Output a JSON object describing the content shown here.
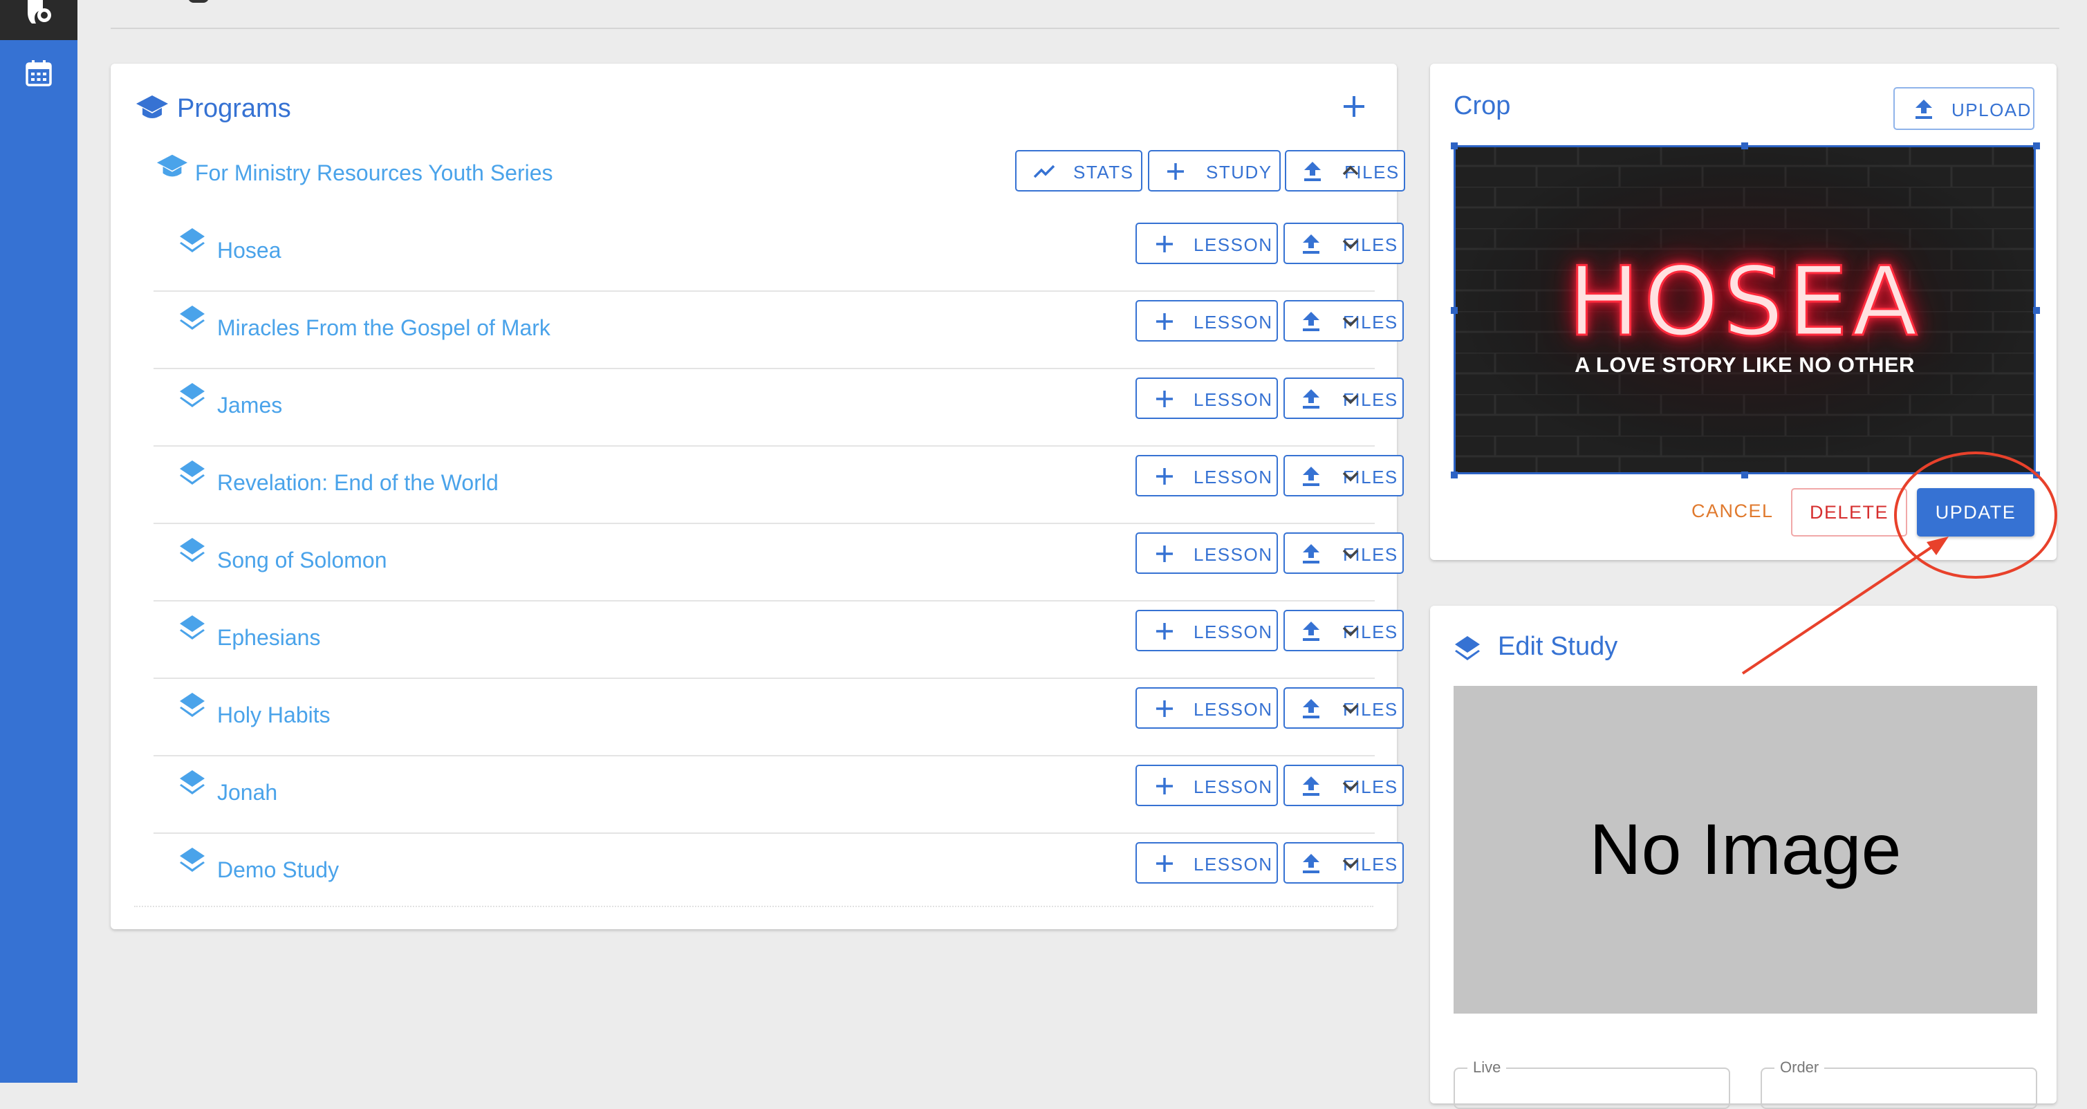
{
  "colors": {
    "accent": "#3672d3",
    "link": "#4aa3ea",
    "annotation": "#e8412b",
    "danger": "#d62f2f",
    "warning": "#e07a2e"
  },
  "nav": {
    "icons": [
      "logo-icon",
      "calendar-icon"
    ]
  },
  "programs": {
    "title": "Programs",
    "add_icon": "plus-icon",
    "series": {
      "name": "For Ministry Resources Youth Series",
      "buttons": {
        "stats": "STATS",
        "study": "STUDY",
        "files": "FILES"
      }
    },
    "studies": [
      {
        "name": "Hosea",
        "lesson": "LESSON",
        "files": "FILES"
      },
      {
        "name": "Miracles From the Gospel of Mark",
        "lesson": "LESSON",
        "files": "FILES"
      },
      {
        "name": "James",
        "lesson": "LESSON",
        "files": "FILES"
      },
      {
        "name": "Revelation: End of the World",
        "lesson": "LESSON",
        "files": "FILES"
      },
      {
        "name": "Song of Solomon",
        "lesson": "LESSON",
        "files": "FILES"
      },
      {
        "name": "Ephesians",
        "lesson": "LESSON",
        "files": "FILES"
      },
      {
        "name": "Holy Habits",
        "lesson": "LESSON",
        "files": "FILES"
      },
      {
        "name": "Jonah",
        "lesson": "LESSON",
        "files": "FILES"
      },
      {
        "name": "Demo Study",
        "lesson": "LESSON",
        "files": "FILES"
      }
    ]
  },
  "crop": {
    "title": "Crop",
    "upload": "UPLOAD",
    "image_title": "HOSEA",
    "image_subtitle": "A LOVE STORY LIKE NO OTHER",
    "cancel": "CANCEL",
    "delete": "DELETE",
    "update": "UPDATE"
  },
  "edit_study": {
    "title": "Edit Study",
    "no_image": "No Image",
    "fields": {
      "live": "Live",
      "order": "Order"
    }
  }
}
